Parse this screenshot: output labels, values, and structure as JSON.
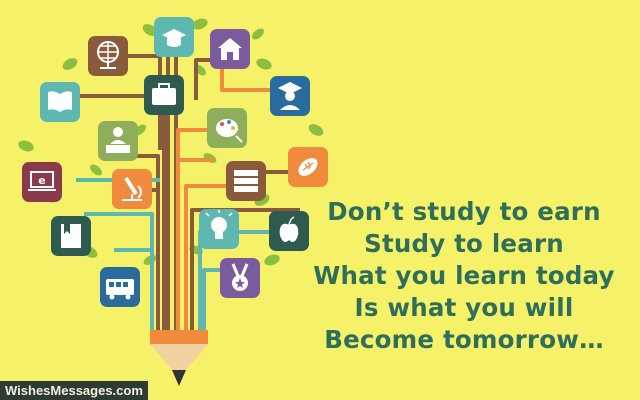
{
  "quote": {
    "lines": [
      "Don’t study to earn",
      "Study to learn",
      "What you learn today",
      "Is what you will",
      "Become tomorrow…"
    ]
  },
  "watermark": "WishesMessages.com",
  "colors": {
    "background": "#f5f26a",
    "text": "#2e6e5a",
    "leaf": "#8cbf3f",
    "branch_brown": "#8a5a3c",
    "branch_orange": "#f08a3c",
    "branch_teal": "#5fb7b1"
  },
  "icons": [
    "globe-icon",
    "graduation-cap-icon",
    "school-house-icon",
    "open-book-icon",
    "briefcase-icon",
    "graduate-student-icon",
    "teacher-desk-icon",
    "art-palette-icon",
    "email-laptop-icon",
    "microscope-icon",
    "books-stack-icon",
    "football-icon",
    "closed-book-icon",
    "light-bulb-icon",
    "apple-icon",
    "school-bus-icon",
    "medal-icon"
  ]
}
